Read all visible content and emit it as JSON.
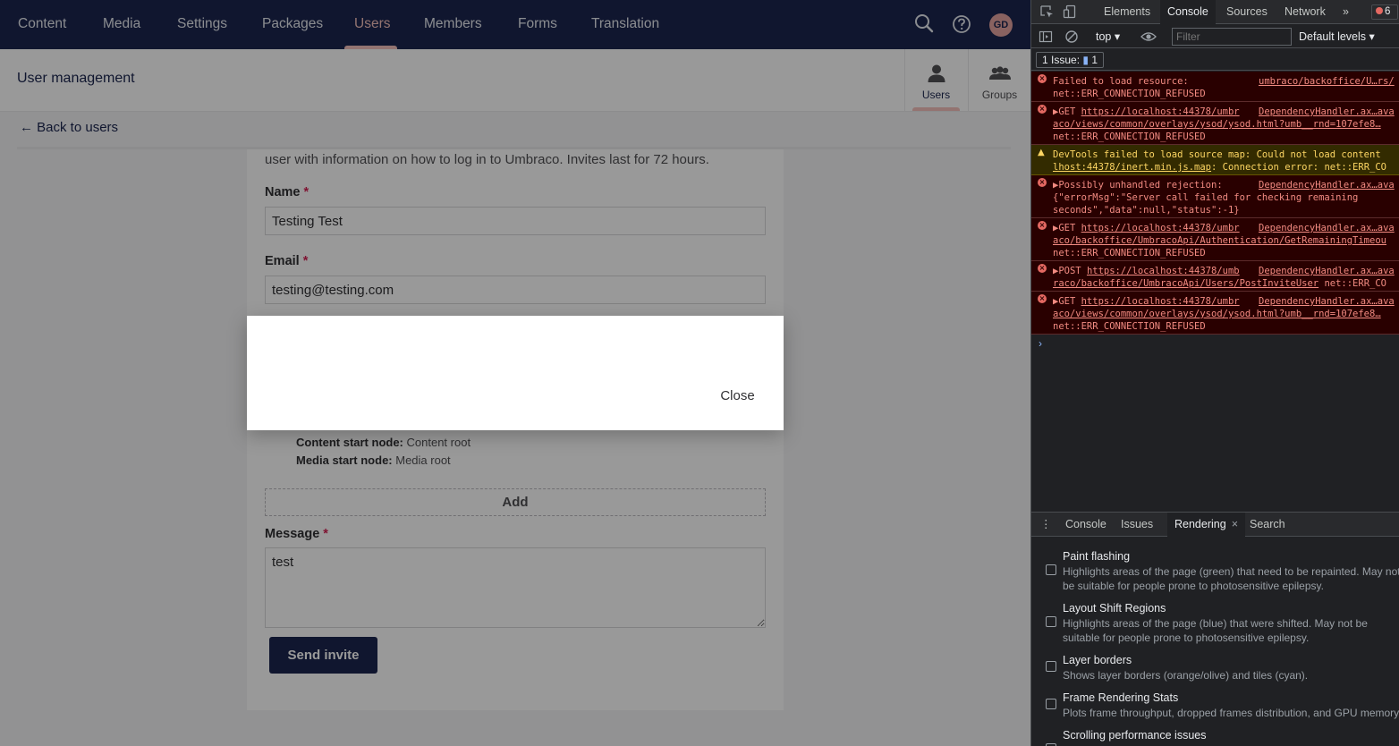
{
  "topbar": {
    "nav": [
      "Content",
      "Media",
      "Settings",
      "Packages",
      "Users",
      "Members",
      "Forms",
      "Translation"
    ],
    "active": "Users",
    "avatar_initials": "GD"
  },
  "subheader": {
    "title": "User management",
    "tabs": [
      {
        "label": "Users"
      },
      {
        "label": "Groups"
      }
    ]
  },
  "back_link": "← Back to users",
  "form": {
    "intro_text": "user with information on how to log in to Umbraco. Invites last for 72 hours.",
    "name_label": "Name",
    "name_value": "Testing Test",
    "email_label": "Email",
    "email_value": "testing@testing.com",
    "content_start_label": "Content start node:",
    "content_start_value": "Content root",
    "media_start_label": "Media start node:",
    "media_start_value": "Media root",
    "add_label": "Add",
    "message_label": "Message",
    "message_value": "test",
    "required_mark": "*",
    "send_label": "Send invite"
  },
  "overlay": {
    "close_label": "Close"
  },
  "devtools": {
    "tabs": [
      "Elements",
      "Console",
      "Sources",
      "Network"
    ],
    "active_tab": "Console",
    "more_tabs": "»",
    "error_count": "6",
    "context": "top ▾",
    "filter_placeholder": "Filter",
    "levels": "Default levels ▾",
    "issues_text": "1 Issue:",
    "issues_count": "1",
    "messages": [
      {
        "kind": "error",
        "line1": "Failed to load resource:",
        "source": "umbraco/backoffice/U…rs/",
        "line2": "net::ERR_CONNECTION_REFUSED"
      },
      {
        "kind": "error",
        "line1_prefix": "▶GET ",
        "line1_link": "https://localhost:44378/umbr",
        "source": "DependencyHandler.ax…ava",
        "line2": "aco/views/common/overlays/ysod/ysod.html?umb__rnd=107efe8…",
        "line3": "net::ERR_CONNECTION_REFUSED"
      },
      {
        "kind": "warning",
        "line1": "DevTools failed to load source map: Could not load content",
        "line2_link": "lhost:44378/inert.min.js.map",
        "line2_rest": ": Connection error: net::ERR_CO"
      },
      {
        "kind": "error",
        "line1": "▶Possibly unhandled rejection:",
        "source": "DependencyHandler.ax…ava",
        "line2": "{\"errorMsg\":\"Server call failed for checking remaining",
        "line3": "seconds\",\"data\":null,\"status\":-1}"
      },
      {
        "kind": "error",
        "line1_prefix": "▶GET ",
        "line1_link": "https://localhost:44378/umbr",
        "source": "DependencyHandler.ax…ava",
        "line2": "aco/backoffice/UmbracoApi/Authentication/GetRemainingTimeou",
        "line3": "net::ERR_CONNECTION_REFUSED"
      },
      {
        "kind": "error",
        "line1_prefix": "▶POST ",
        "line1_link": "https://localhost:44378/umb",
        "source": "DependencyHandler.ax…ava",
        "line2_link": "raco/backoffice/UmbracoApi/Users/PostInviteUser",
        "line2_rest": " net::ERR_CO"
      },
      {
        "kind": "error",
        "line1_prefix": "▶GET ",
        "line1_link": "https://localhost:44378/umbr",
        "source": "DependencyHandler.ax…ava",
        "line2": "aco/views/common/overlays/ysod/ysod.html?umb__rnd=107efe8…",
        "line3": "net::ERR_CONNECTION_REFUSED"
      }
    ],
    "prompt": "›",
    "drawer": {
      "menu": "⋮",
      "tabs": [
        "Console",
        "Issues",
        "Rendering",
        "Search"
      ],
      "active_tab": "Rendering",
      "close": "×",
      "options": [
        {
          "title": "Paint flashing",
          "desc": "Highlights areas of the page (green) that need to be repainted. May not be suitable for people prone to photosensitive epilepsy."
        },
        {
          "title": "Layout Shift Regions",
          "desc": "Highlights areas of the page (blue) that were shifted. May not be suitable for people prone to photosensitive epilepsy."
        },
        {
          "title": "Layer borders",
          "desc": "Shows layer borders (orange/olive) and tiles (cyan)."
        },
        {
          "title": "Frame Rendering Stats",
          "desc": "Plots frame throughput, dropped frames distribution, and GPU memory."
        },
        {
          "title": "Scrolling performance issues",
          "desc": ""
        }
      ]
    }
  }
}
